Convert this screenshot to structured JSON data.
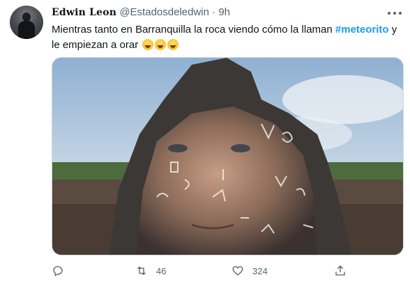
{
  "tweet": {
    "author_name": "Edwin Leon",
    "handle": "@Estadosdeledwin",
    "separator": "·",
    "time": "9h",
    "text_before": "Mientras tanto en Barranquilla la roca viendo cómo la llaman ",
    "hashtag": "#meteorito",
    "text_after": " y le empiezan a orar",
    "emojis": [
      "face-with-tears-of-joy",
      "face-with-tears-of-joy",
      "face-with-tears-of-joy"
    ],
    "media_description_icon": "photo"
  },
  "actions": {
    "reply_icon": "reply-icon",
    "retweet_icon": "retweet-icon",
    "retweet_count": "46",
    "like_icon": "heart-icon",
    "like_count": "324",
    "share_icon": "share-icon"
  },
  "colors": {
    "text": "#0f1419",
    "secondary": "#536471",
    "accent": "#1d9bf0",
    "border": "#cfd9de"
  }
}
